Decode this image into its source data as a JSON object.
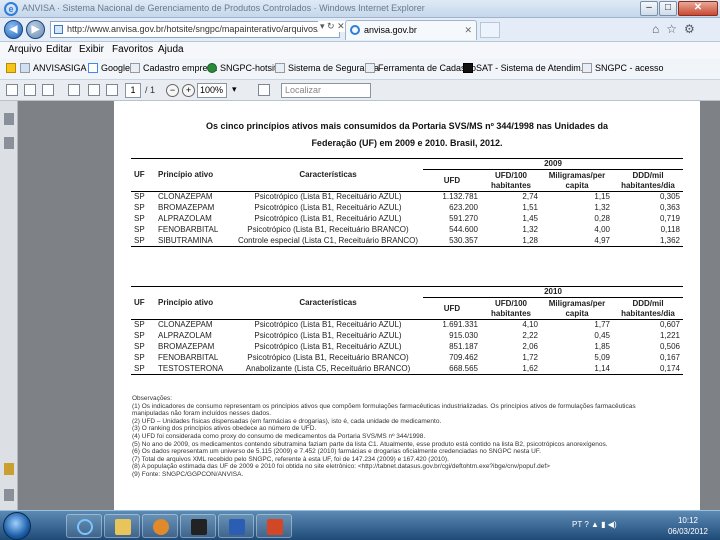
{
  "window": {
    "title": "ANVISA · Sistema Nacional de Gerenciamento de Produtos Controlados · Windows Internet Explorer"
  },
  "browser": {
    "address": "http://www.anvisa.gov.br/hotsite/sngpc/mapainterativo/arquivos/Tabela",
    "tab_label": "anvisa.gov.br",
    "menu": [
      "Arquivo",
      "Editar",
      "Exibir",
      "Favoritos",
      "Ajuda"
    ],
    "favorites": [
      "ANVISA",
      "SIGA",
      "Google",
      "Cadastro empresa",
      "SNGPC-hotsite",
      "Sistema de Segurança",
      "Ferramenta de Cadastro",
      "SAT - Sistema de Atendim...",
      "SNGPC - acesso"
    ],
    "page_current": "1",
    "page_total": "/ 1",
    "zoom": "100%",
    "find_placeholder": "Localizar"
  },
  "document": {
    "title_line1": "Os cinco princípios ativos mais consumidos da Portaria SVS/MS nº 344/1998 nas Unidades da",
    "title_line2": "Federação (UF) em 2009 e 2010. Brasil, 2012.",
    "table2009": {
      "year": "2009",
      "headers": [
        "UF",
        "Princípio ativo",
        "Características",
        "UFD",
        "UFD/100 habitantes",
        "Miligramas/per capita",
        "DDD/mil habitantes/dia"
      ],
      "rows": [
        [
          "SP",
          "CLONAZEPAM",
          "Psicotrópico (Lista B1, Receituário AZUL)",
          "1.132.781",
          "2,74",
          "1,15",
          "0,305"
        ],
        [
          "SP",
          "BROMAZEPAM",
          "Psicotrópico (Lista B1, Receituário AZUL)",
          "623.200",
          "1,51",
          "1,32",
          "0,363"
        ],
        [
          "SP",
          "ALPRAZOLAM",
          "Psicotrópico (Lista B1, Receituário AZUL)",
          "591.270",
          "1,45",
          "0,28",
          "0,719"
        ],
        [
          "SP",
          "FENOBARBITAL",
          "Psicotrópico (Lista B1, Receituário BRANCO)",
          "544.600",
          "1,32",
          "4,00",
          "0,118"
        ],
        [
          "SP",
          "SIBUTRAMINA",
          "Controle especial (Lista C1, Receituário BRANCO)",
          "530.357",
          "1,28",
          "4,97",
          "1,362"
        ]
      ]
    },
    "table2010": {
      "year": "2010",
      "headers": [
        "UF",
        "Princípio ativo",
        "Características",
        "UFD",
        "UFD/100 habitantes",
        "Miligramas/per capita",
        "DDD/mil habitantes/dia"
      ],
      "rows": [
        [
          "SP",
          "CLONAZEPAM",
          "Psicotrópico (Lista B1, Receituário AZUL)",
          "1.691.331",
          "4,10",
          "1,77",
          "0,607"
        ],
        [
          "SP",
          "ALPRAZOLAM",
          "Psicotrópico (Lista B1, Receituário AZUL)",
          "915.030",
          "2,22",
          "0,45",
          "1,221"
        ],
        [
          "SP",
          "BROMAZEPAM",
          "Psicotrópico (Lista B1, Receituário AZUL)",
          "851.187",
          "2,06",
          "1,85",
          "0,506"
        ],
        [
          "SP",
          "FENOBARBITAL",
          "Psicotrópico (Lista B1, Receituário BRANCO)",
          "709.462",
          "1,72",
          "5,09",
          "0,167"
        ],
        [
          "SP",
          "TESTOSTERONA",
          "Anabolizante (Lista C5, Receituário BRANCO)",
          "668.565",
          "1,62",
          "1,14",
          "0,174"
        ]
      ]
    },
    "notes": [
      "Observações:",
      "(1) Os indicadores de consumo representam os princípios ativos que compõem formulações farmacêuticas industrializadas. Os princípios ativos de formulações farmacêuticas",
      "manipuladas não foram incluídos nesses dados.",
      "(2) UFD – Unidades físicas dispensadas (em farmácias e drogarias), isto é, cada unidade de medicamento.",
      "(3) O ranking dos princípios ativos obedece ao número de UFD.",
      "(4) UFD foi considerada como proxy do consumo de medicamentos da Portaria SVS/MS nº 344/1998.",
      "(5) No ano de 2009, os medicamentos contendo sibutramina faziam parte da lista C1. Atualmente, esse produto está contido na lista B2, psicotrópicos anorexígenos.",
      "(6) Os dados representam um universo de 5.115 (2009) e 7.452 (2010) farmácias e drogarias oficialmente credenciadas no SNGPC nesta UF.",
      "(7) Total de arquivos XML recebido pelo SNGPC, referente à esta UF, foi de 147.234 (2009) e 167.420 (2010).",
      "(8) A população estimada das UF de 2009 e 2010 foi obtida no site eletrônico: <http://tabnet.datasus.gov.br/cgi/deftohtm.exe?ibge/cnv/popuf.def>",
      "(9) Fonte: SNGPC/GGPCON/ANVISA."
    ]
  },
  "taskbar": {
    "lang": "PT",
    "time": "10:12",
    "date": "06/03/2012"
  }
}
